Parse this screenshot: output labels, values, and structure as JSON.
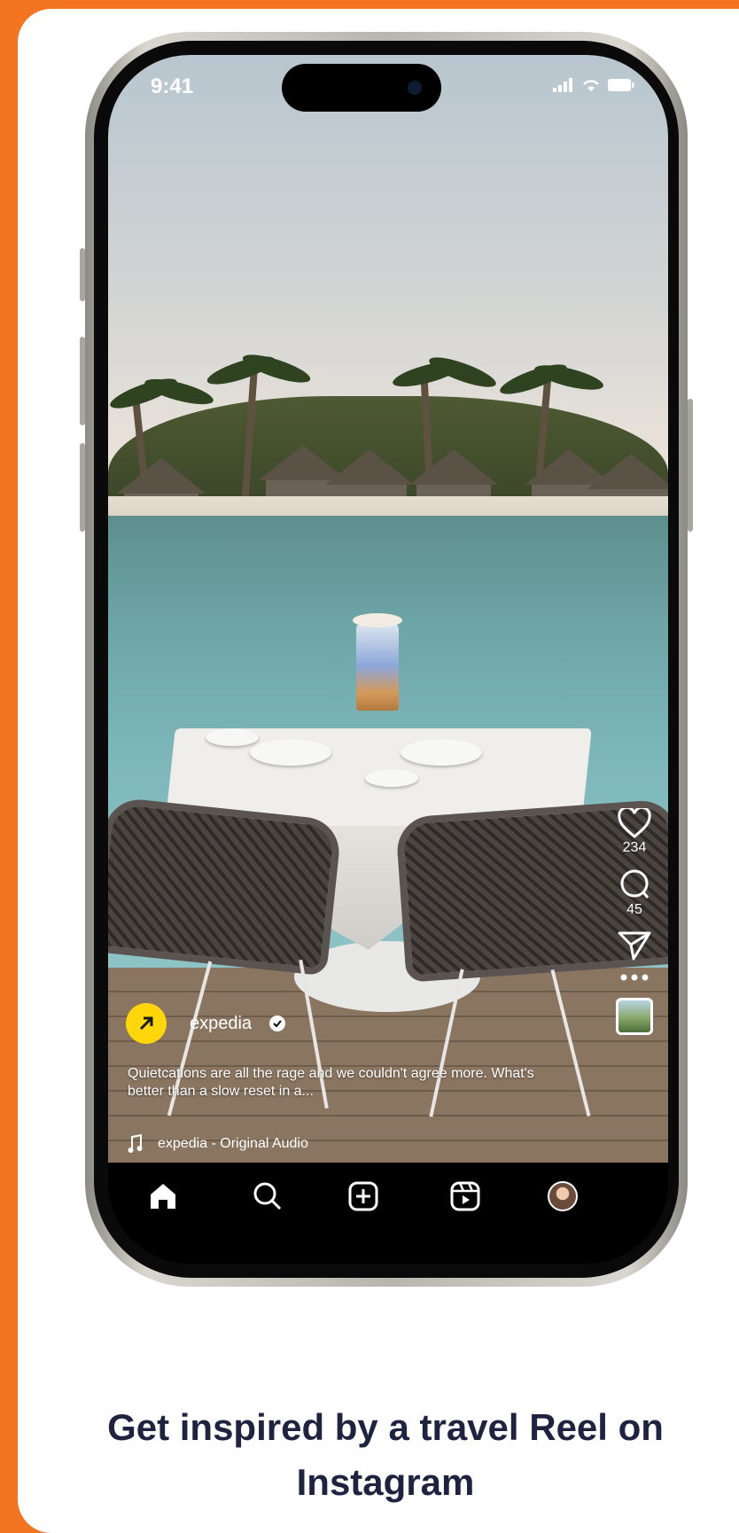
{
  "status_bar": {
    "time": "9:41"
  },
  "reel": {
    "author": "expedia",
    "caption": "Quietcations are all the rage and we couldn't agree more. What's better than a slow reset in a...",
    "audio": "expedia - Original Audio",
    "likes": "234",
    "comments": "45"
  },
  "nav": {
    "items": [
      "home-icon",
      "search-icon",
      "create-icon",
      "reels-icon",
      "profile-avatar"
    ]
  },
  "headline": "Get inspired by a travel Reel on Instagram",
  "colors": {
    "background": "#f47521",
    "headline": "#1f2340",
    "expedia_yellow": "#ffd60a"
  }
}
